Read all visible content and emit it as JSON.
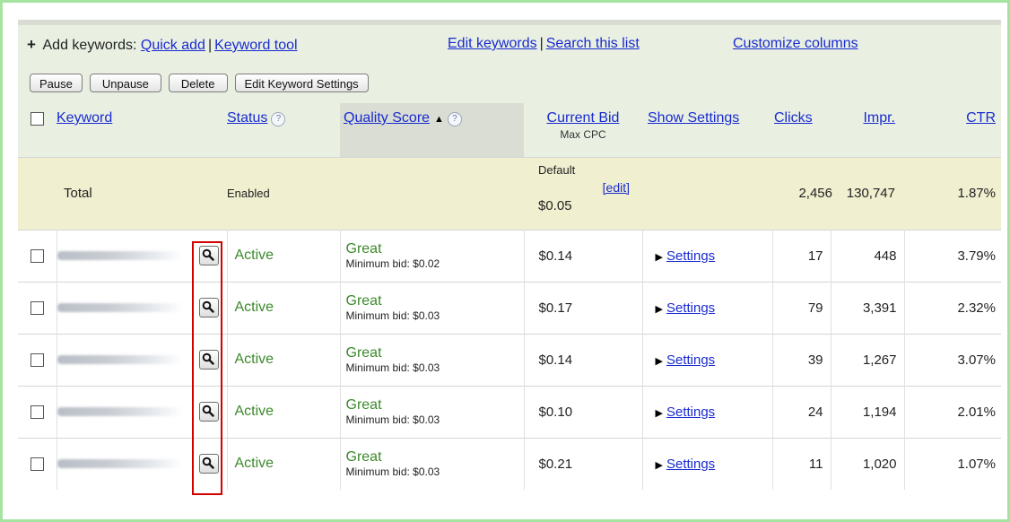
{
  "toolbar": {
    "plus": "+",
    "add_keywords_label": "Add keywords:",
    "quick_add": "Quick add",
    "sep1": "|",
    "keyword_tool": "Keyword tool",
    "edit_keywords": "Edit keywords",
    "sep2": "|",
    "search_list": "Search this list",
    "customize_columns": "Customize columns",
    "buttons": [
      "Pause",
      "Unpause",
      "Delete",
      "Edit Keyword Settings"
    ]
  },
  "columns": {
    "keyword": "Keyword",
    "status": "Status",
    "quality_score": "Quality Score",
    "sort_arrow": "▲",
    "current_bid": "Current Bid",
    "current_bid_sub": "Max CPC",
    "show_settings": "Show Settings",
    "clicks": "Clicks",
    "impr": "Impr.",
    "ctr": "CTR",
    "help": "?"
  },
  "total": {
    "label": "Total",
    "status": "Enabled",
    "bid_label": "Default",
    "bid_edit": "[edit]",
    "bid_value": "$0.05",
    "clicks": "2,456",
    "impr": "130,747",
    "ctr": "1.87%"
  },
  "rows": [
    {
      "status": "Active",
      "qs": "Great",
      "min_bid": "Minimum bid: $0.02",
      "bid": "$0.14",
      "settings": "Settings",
      "clicks": "17",
      "impr": "448",
      "ctr": "3.79%"
    },
    {
      "status": "Active",
      "qs": "Great",
      "min_bid": "Minimum bid: $0.03",
      "bid": "$0.17",
      "settings": "Settings",
      "clicks": "79",
      "impr": "3,391",
      "ctr": "2.32%"
    },
    {
      "status": "Active",
      "qs": "Great",
      "min_bid": "Minimum bid: $0.03",
      "bid": "$0.14",
      "settings": "Settings",
      "clicks": "39",
      "impr": "1,267",
      "ctr": "3.07%"
    },
    {
      "status": "Active",
      "qs": "Great",
      "min_bid": "Minimum bid: $0.03",
      "bid": "$0.10",
      "settings": "Settings",
      "clicks": "24",
      "impr": "1,194",
      "ctr": "2.01%"
    },
    {
      "status": "Active",
      "qs": "Great",
      "min_bid": "Minimum bid: $0.03",
      "bid": "$0.21",
      "settings": "Settings",
      "clicks": "11",
      "impr": "1,020",
      "ctr": "1.07%"
    }
  ],
  "colors": {
    "link": "#1a2bd0",
    "status_active": "#3c8a2a",
    "highlight": "#d40000",
    "frame": "#a6e3a1"
  },
  "icons": {
    "search_row": "magnifier-icon",
    "help": "question-circle-icon",
    "expand": "triangle-right-icon"
  }
}
